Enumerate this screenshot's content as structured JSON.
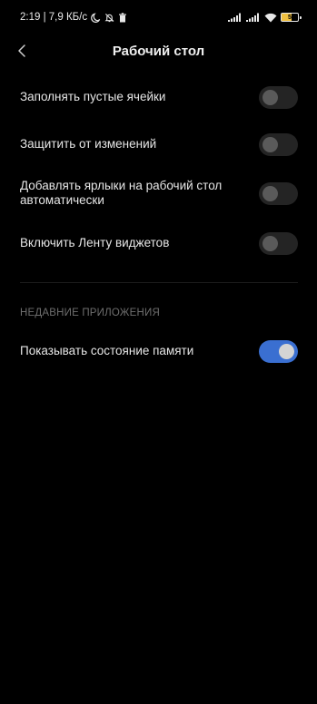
{
  "status_bar": {
    "time_speed": "2:19 | 7,9 КБ/с",
    "battery_level": "5",
    "battery_fraction": 0.05,
    "icons": [
      "moon-icon",
      "bell-off-icon",
      "trash-icon",
      "signal-icon",
      "signal-icon",
      "wifi-icon",
      "battery-icon"
    ]
  },
  "header": {
    "title": "Рабочий стол"
  },
  "settings": [
    {
      "label": "Заполнять пустые ячейки",
      "enabled": false
    },
    {
      "label": "Защитить от изменений",
      "enabled": false
    },
    {
      "label": "Добавлять ярлыки на рабочий стол автоматически",
      "enabled": false
    },
    {
      "label": "Включить Ленту виджетов",
      "enabled": false
    }
  ],
  "recent_section": {
    "header": "НЕДАВНИЕ ПРИЛОЖЕНИЯ",
    "items": [
      {
        "label": "Показывать состояние памяти",
        "enabled": true
      }
    ]
  },
  "colors": {
    "background": "#000000",
    "toggle_on": "#3a6fd1",
    "toggle_off": "#242424",
    "battery": "#f0c040"
  }
}
